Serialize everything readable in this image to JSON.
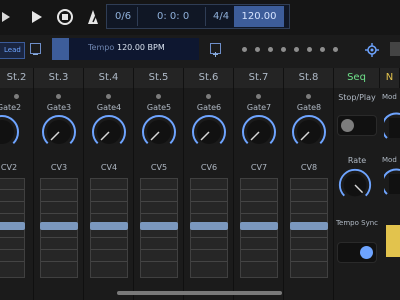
{
  "transport": {
    "steps": "0/6",
    "position": "0: 0: 0",
    "time_signature": "4/4",
    "bpm": "120.00"
  },
  "track": {
    "name": "Lead"
  },
  "tempo": {
    "label": "Tempo",
    "value": "120.00 BPM"
  },
  "strips": [
    {
      "title": "St.2",
      "gate": "Gate2",
      "cv": "CV2"
    },
    {
      "title": "St.3",
      "gate": "Gate3",
      "cv": "CV3"
    },
    {
      "title": "St.4",
      "gate": "Gate4",
      "cv": "CV4"
    },
    {
      "title": "St.5",
      "gate": "Gate5",
      "cv": "CV5"
    },
    {
      "title": "St.6",
      "gate": "Gate6",
      "cv": "CV6"
    },
    {
      "title": "St.7",
      "gate": "Gate7",
      "cv": "CV7"
    },
    {
      "title": "St.8",
      "gate": "Gate8",
      "cv": "CV8"
    }
  ],
  "seq": {
    "title": "Seq",
    "stop_play": "Stop/Play",
    "rate": "Rate",
    "tempo_sync": "Tempo Sync",
    "mod_label": "Mod",
    "next_header": "N"
  },
  "colors": {
    "accent": "#6ea4ff",
    "seq_title": "#6ee08a",
    "next_header": "#e2c34d"
  },
  "icons": [
    "play-icon",
    "stop-icon",
    "metronome-icon",
    "settings-icon"
  ]
}
